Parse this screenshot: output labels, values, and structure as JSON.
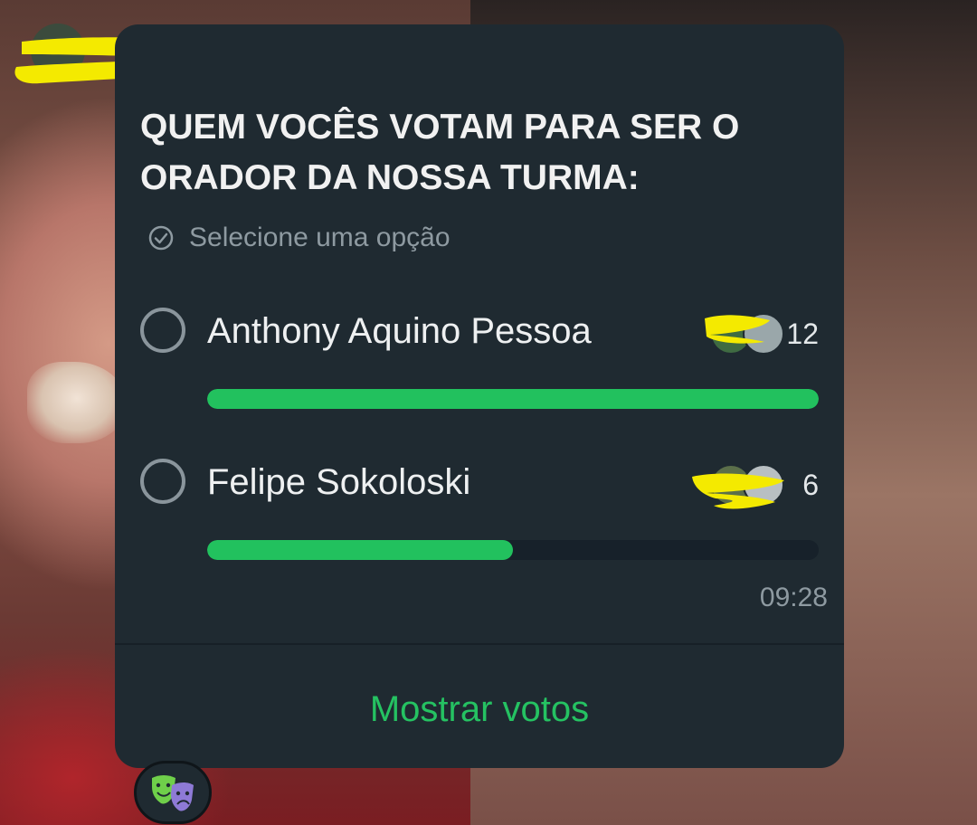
{
  "poll": {
    "question": "QUEM VOCÊS VOTAM PARA SER O ORADOR DA NOSSA TURMA:",
    "hint": "Selecione uma opção",
    "options": [
      {
        "label": "Anthony Aquino Pessoa",
        "votes": "12",
        "fraction": 1.0
      },
      {
        "label": "Felipe Sokoloski",
        "votes": "6",
        "fraction": 0.5
      }
    ],
    "timestamp": "09:28",
    "show_votes_label": "Mostrar votos"
  },
  "colors": {
    "bubble": "#1f2a31",
    "accent_green": "#22c15e",
    "redaction": "#f4ea00",
    "muted_text": "#8e9aa1"
  },
  "icons": {
    "hint": "check-circle-icon",
    "reaction": "theater-masks-icon"
  }
}
